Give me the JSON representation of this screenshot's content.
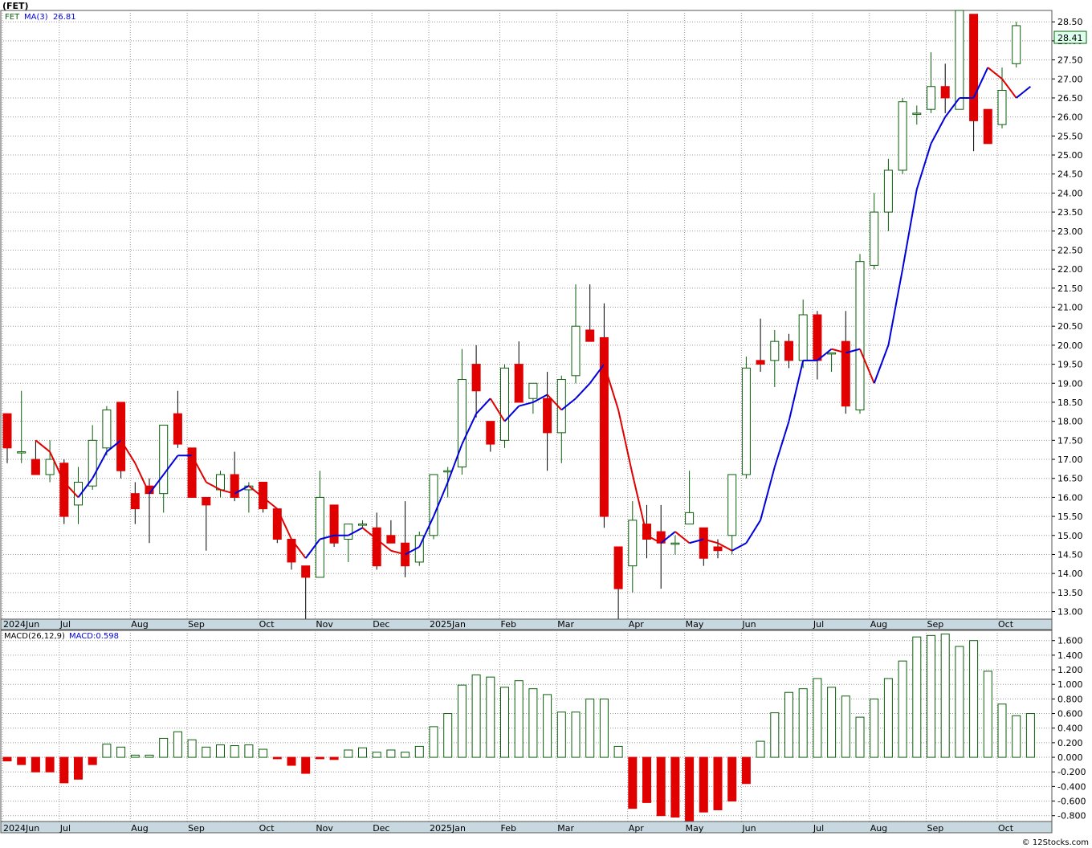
{
  "title": "(FET)",
  "footer": "© 12Stocks.com",
  "price_panel": {
    "symbol_label": "FET",
    "ma_label": "MA(3)",
    "ma_value": "26.81",
    "last_price": "28.41"
  },
  "macd_panel": {
    "label": "MACD(26,12,9)",
    "value_label": "MACD:0.598"
  },
  "colors": {
    "up_candle": "#0a5f0a",
    "down_candle": "#e00000",
    "ma_up": "#0000dd",
    "ma_down": "#e00000",
    "axis_band": "#c8d8e0"
  },
  "chart_data": [
    {
      "type": "candlestick",
      "timeframe": "weekly",
      "y_ticks": [
        "13.00",
        "13.50",
        "14.00",
        "14.50",
        "15.00",
        "15.50",
        "16.00",
        "16.50",
        "17.00",
        "17.50",
        "18.00",
        "18.50",
        "19.00",
        "19.50",
        "20.00",
        "20.50",
        "21.00",
        "21.50",
        "22.00",
        "22.50",
        "23.00",
        "23.50",
        "24.00",
        "24.50",
        "25.00",
        "25.50",
        "26.00",
        "26.50",
        "27.00",
        "27.50",
        "28.00",
        "28.50"
      ],
      "ylim": [
        12.8,
        28.8
      ],
      "x_labels": [
        "2024Jun",
        "Jul",
        "Aug",
        "Sep",
        "Oct",
        "Nov",
        "Dec",
        "2025Jan",
        "Feb",
        "Mar",
        "Apr",
        "May",
        "Jun",
        "Jul",
        "Aug",
        "Sep",
        "Oct"
      ],
      "x_label_weeks": [
        0,
        4,
        9,
        13,
        18,
        22,
        26,
        30,
        35,
        39,
        44,
        48,
        52,
        57,
        61,
        65,
        70
      ],
      "ohlc": [
        [
          18.2,
          18.2,
          16.9,
          17.3
        ],
        [
          17.2,
          18.8,
          16.9,
          17.2
        ],
        [
          17.0,
          17.5,
          16.6,
          16.6
        ],
        [
          16.6,
          17.5,
          16.4,
          17.0
        ],
        [
          16.9,
          17.0,
          15.3,
          15.5
        ],
        [
          15.8,
          16.8,
          15.3,
          16.4
        ],
        [
          16.3,
          17.9,
          16.2,
          17.5
        ],
        [
          17.3,
          18.4,
          17.1,
          18.3
        ],
        [
          18.5,
          18.5,
          16.5,
          16.7
        ],
        [
          16.1,
          16.4,
          15.3,
          15.7
        ],
        [
          16.3,
          16.5,
          14.8,
          16.1
        ],
        [
          16.1,
          17.9,
          15.6,
          17.9
        ],
        [
          18.2,
          18.8,
          17.3,
          17.4
        ],
        [
          17.3,
          17.3,
          16.0,
          16.0
        ],
        [
          16.0,
          16.0,
          14.6,
          15.8
        ],
        [
          16.2,
          16.7,
          16.0,
          16.6
        ],
        [
          16.6,
          17.2,
          15.9,
          16.0
        ],
        [
          16.2,
          16.4,
          15.6,
          16.3
        ],
        [
          16.4,
          16.4,
          15.6,
          15.7
        ],
        [
          15.7,
          15.7,
          14.8,
          14.9
        ],
        [
          14.9,
          14.9,
          14.1,
          14.3
        ],
        [
          14.2,
          14.2,
          12.8,
          13.9
        ],
        [
          13.9,
          16.7,
          13.9,
          16.0
        ],
        [
          15.8,
          15.8,
          14.7,
          14.8
        ],
        [
          14.9,
          15.3,
          14.3,
          15.3
        ],
        [
          15.3,
          15.4,
          15.2,
          15.3
        ],
        [
          15.2,
          15.6,
          14.1,
          14.2
        ],
        [
          15.0,
          15.4,
          14.8,
          14.8
        ],
        [
          14.8,
          15.9,
          13.9,
          14.2
        ],
        [
          14.3,
          15.1,
          14.2,
          15.0
        ],
        [
          15.0,
          16.0,
          14.9,
          16.6
        ],
        [
          16.7,
          16.8,
          16.0,
          16.7
        ],
        [
          16.8,
          19.9,
          16.6,
          19.1
        ],
        [
          19.5,
          20.0,
          18.1,
          18.8
        ],
        [
          18.0,
          18.0,
          17.2,
          17.4
        ],
        [
          17.5,
          19.5,
          17.3,
          19.4
        ],
        [
          19.5,
          20.1,
          18.5,
          18.5
        ],
        [
          18.6,
          18.7,
          18.2,
          19.0
        ],
        [
          18.6,
          19.3,
          16.7,
          17.7
        ],
        [
          17.7,
          19.2,
          16.9,
          19.1
        ],
        [
          19.2,
          21.6,
          19.0,
          20.5
        ],
        [
          20.4,
          21.6,
          20.1,
          20.1
        ],
        [
          20.2,
          21.1,
          15.2,
          15.5
        ],
        [
          14.7,
          14.7,
          12.8,
          13.6
        ],
        [
          14.2,
          15.9,
          13.5,
          15.4
        ],
        [
          15.3,
          15.8,
          14.4,
          14.9
        ],
        [
          15.1,
          15.8,
          13.6,
          14.8
        ],
        [
          14.8,
          15.0,
          14.5,
          14.8
        ],
        [
          15.3,
          16.7,
          15.4,
          15.6
        ],
        [
          15.2,
          15.2,
          14.2,
          14.4
        ],
        [
          14.7,
          14.9,
          14.4,
          14.6
        ],
        [
          15.0,
          16.6,
          14.5,
          16.6
        ],
        [
          16.6,
          19.7,
          16.5,
          19.4
        ],
        [
          19.6,
          20.7,
          19.3,
          19.5
        ],
        [
          19.6,
          20.4,
          18.9,
          20.1
        ],
        [
          20.1,
          20.3,
          19.4,
          19.6
        ],
        [
          19.6,
          21.2,
          19.4,
          20.8
        ],
        [
          20.8,
          20.9,
          19.1,
          19.6
        ],
        [
          19.8,
          19.8,
          19.3,
          19.8
        ],
        [
          20.1,
          20.9,
          18.2,
          18.4
        ],
        [
          18.3,
          22.4,
          18.2,
          22.2
        ],
        [
          22.1,
          24.0,
          22.0,
          23.5
        ],
        [
          23.5,
          24.9,
          23.0,
          24.6
        ],
        [
          24.6,
          26.5,
          24.5,
          26.4
        ],
        [
          26.1,
          26.3,
          25.8,
          26.1
        ],
        [
          26.2,
          27.7,
          26.1,
          26.8
        ],
        [
          26.8,
          27.4,
          26.1,
          26.5
        ],
        [
          26.2,
          28.8,
          26.2,
          28.8
        ],
        [
          28.7,
          28.7,
          25.1,
          25.9
        ],
        [
          26.2,
          26.2,
          25.3,
          25.3
        ],
        [
          25.8,
          27.3,
          25.7,
          26.7
        ],
        [
          27.4,
          28.5,
          27.3,
          28.4
        ]
      ],
      "ma": {
        "name": "MA(3)",
        "values": [
          null,
          null,
          17.5,
          17.2,
          16.4,
          16.0,
          16.5,
          17.2,
          17.5,
          16.9,
          16.1,
          16.6,
          17.1,
          17.1,
          16.4,
          16.2,
          16.1,
          16.3,
          16.0,
          15.7,
          14.9,
          14.4,
          14.9,
          15.0,
          15.0,
          15.2,
          14.9,
          14.6,
          14.5,
          14.7,
          15.5,
          16.4,
          17.4,
          18.2,
          18.6,
          18.0,
          18.4,
          18.5,
          18.7,
          18.3,
          18.6,
          19.0,
          19.5,
          18.3,
          16.6,
          15.0,
          14.8,
          15.1,
          14.8,
          14.9,
          14.8,
          14.6,
          14.8,
          15.4,
          16.8,
          18.0,
          19.6,
          19.6,
          19.9,
          19.8,
          19.9,
          19.0,
          20.0,
          22.0,
          24.1,
          25.3,
          26.0,
          26.5,
          26.5,
          27.3,
          27.0,
          26.5,
          26.8
        ]
      },
      "series": [
        {
          "name": "FET",
          "role": "price"
        },
        {
          "name": "MA(3)",
          "role": "moving-average"
        }
      ]
    },
    {
      "type": "bar",
      "name": "MACD(26,12,9)",
      "y_ticks": [
        "-0.800",
        "-0.600",
        "-0.400",
        "-0.200",
        "0.000",
        "0.200",
        "0.400",
        "0.600",
        "0.800",
        "1.000",
        "1.200",
        "1.400",
        "1.600"
      ],
      "ylim": [
        -0.88,
        1.74
      ],
      "x_labels": [
        "2024Jun",
        "Jul",
        "Aug",
        "Sep",
        "Oct",
        "Nov",
        "Dec",
        "2025Jan",
        "Feb",
        "Mar",
        "Apr",
        "May",
        "Jun",
        "Jul",
        "Aug",
        "Sep",
        "Oct"
      ],
      "values": [
        -0.05,
        -0.1,
        -0.2,
        -0.2,
        -0.35,
        -0.3,
        -0.1,
        0.18,
        0.14,
        0.03,
        0.03,
        0.26,
        0.35,
        0.24,
        0.14,
        0.17,
        0.16,
        0.17,
        0.11,
        -0.02,
        -0.11,
        -0.22,
        -0.02,
        -0.03,
        0.1,
        0.13,
        0.07,
        0.1,
        0.07,
        0.15,
        0.42,
        0.6,
        0.99,
        1.13,
        1.1,
        0.96,
        1.05,
        0.94,
        0.86,
        0.62,
        0.62,
        0.8,
        0.8,
        0.15,
        -0.7,
        -0.62,
        -0.8,
        -0.82,
        -0.88,
        -0.75,
        -0.72,
        -0.6,
        -0.36,
        0.22,
        0.61,
        0.89,
        0.94,
        1.08,
        0.96,
        0.84,
        0.55,
        0.8,
        1.08,
        1.32,
        1.65,
        1.67,
        1.69,
        1.52,
        1.6,
        1.18,
        0.73,
        0.57,
        0.6
      ]
    }
  ]
}
